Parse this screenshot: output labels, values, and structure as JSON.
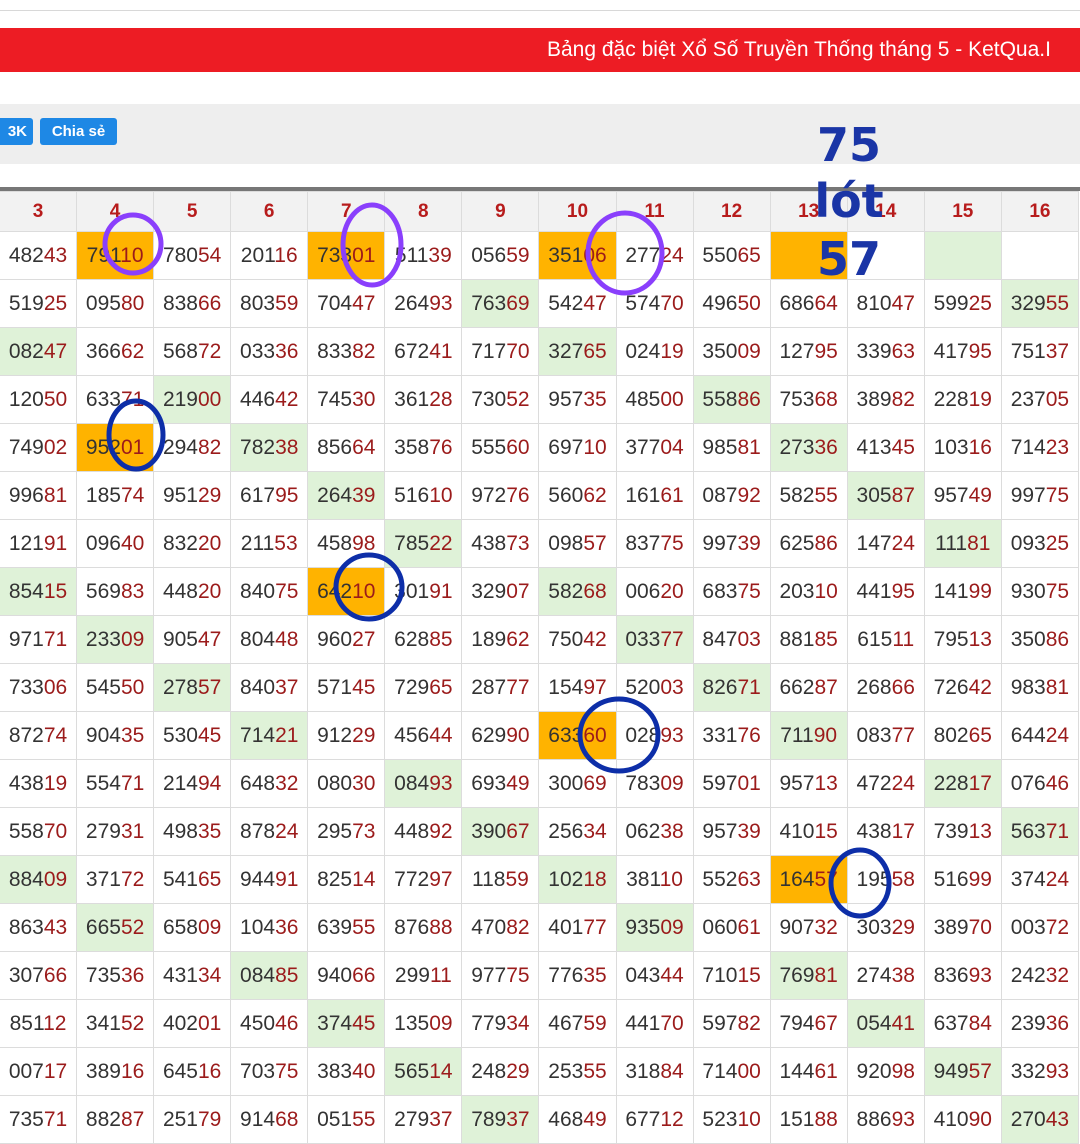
{
  "title": "Bảng đặc biệt Xổ Số Truyền Thống tháng 5 - KetQua.I",
  "toolbar": {
    "btn_1": "3K",
    "btn_2": "Chia sẻ"
  },
  "colors": {
    "title_bg": "#ed1c24",
    "button": "#1e88e5",
    "highlight_yellow": "#ffb300",
    "highlight_green": "#dff2d8",
    "circle_purple": "#8a3ffc",
    "circle_blue": "#0d2ea8",
    "annotation_text": "#1a35a6"
  },
  "headers": [
    "3",
    "4",
    "5",
    "6",
    "7",
    "8",
    "9",
    "10",
    "11",
    "12",
    "13",
    "14",
    "15",
    "16"
  ],
  "rows": [
    [
      "48243",
      "79110",
      "78054",
      "20116",
      "73301",
      "51139",
      "05659",
      "35106",
      "27724",
      "55065",
      "",
      "",
      "",
      ""
    ],
    [
      "51925",
      "09580",
      "83866",
      "80359",
      "70447",
      "26493",
      "76369",
      "54247",
      "57470",
      "49650",
      "68664",
      "81047",
      "59925",
      "32955"
    ],
    [
      "08247",
      "36662",
      "56872",
      "03336",
      "83382",
      "67241",
      "71770",
      "32765",
      "02419",
      "35009",
      "12795",
      "33963",
      "41795",
      "75137"
    ],
    [
      "12050",
      "63371",
      "21900",
      "44642",
      "74530",
      "36128",
      "73052",
      "95735",
      "48500",
      "55886",
      "75368",
      "38982",
      "22819",
      "23705"
    ],
    [
      "74902",
      "95201",
      "29482",
      "78238",
      "85664",
      "35876",
      "55560",
      "69710",
      "37704",
      "98581",
      "27336",
      "41345",
      "10316",
      "71423"
    ],
    [
      "99681",
      "18574",
      "95129",
      "61795",
      "26439",
      "51610",
      "97276",
      "56062",
      "16161",
      "08792",
      "58255",
      "30587",
      "95749",
      "99775"
    ],
    [
      "12191",
      "09640",
      "83220",
      "21153",
      "45898",
      "78522",
      "43873",
      "09857",
      "83775",
      "99739",
      "62586",
      "14724",
      "11181",
      "09325"
    ],
    [
      "85415",
      "56983",
      "44820",
      "84075",
      "64210",
      "30191",
      "32907",
      "58268",
      "00620",
      "68375",
      "20310",
      "44195",
      "14199",
      "93075"
    ],
    [
      "97171",
      "23309",
      "90547",
      "80448",
      "96027",
      "62885",
      "18962",
      "75042",
      "03377",
      "84703",
      "88185",
      "61511",
      "79513",
      "35086"
    ],
    [
      "73306",
      "54550",
      "27857",
      "84037",
      "57145",
      "72965",
      "28777",
      "15497",
      "52003",
      "82671",
      "66287",
      "26866",
      "72642",
      "98381"
    ],
    [
      "87274",
      "90435",
      "53045",
      "71421",
      "91229",
      "45644",
      "62990",
      "63360",
      "02893",
      "33176",
      "71190",
      "08377",
      "80265",
      "64424"
    ],
    [
      "43819",
      "55471",
      "21494",
      "64832",
      "08030",
      "08493",
      "69349",
      "30069",
      "78309",
      "59701",
      "95713",
      "47224",
      "22817",
      "07646"
    ],
    [
      "55870",
      "27931",
      "49835",
      "87824",
      "29573",
      "44892",
      "39067",
      "25634",
      "06238",
      "95739",
      "41015",
      "43817",
      "73913",
      "56371"
    ],
    [
      "88409",
      "37172",
      "54165",
      "94491",
      "82514",
      "77297",
      "11859",
      "10218",
      "38110",
      "55263",
      "16457",
      "19558",
      "51699",
      "37424"
    ],
    [
      "86343",
      "66552",
      "65809",
      "10436",
      "63955",
      "87688",
      "47082",
      "40177",
      "93509",
      "06061",
      "90732",
      "30329",
      "38970",
      "00372"
    ],
    [
      "30766",
      "73536",
      "43134",
      "08485",
      "94066",
      "29911",
      "97775",
      "77635",
      "04344",
      "71015",
      "76981",
      "27438",
      "83693",
      "24232"
    ],
    [
      "85112",
      "34152",
      "40201",
      "45046",
      "37445",
      "13509",
      "77934",
      "46759",
      "44170",
      "59782",
      "79467",
      "05441",
      "63784",
      "23936"
    ],
    [
      "00717",
      "38916",
      "64516",
      "70375",
      "38340",
      "56514",
      "24829",
      "25355",
      "31884",
      "71400",
      "14461",
      "92098",
      "94957",
      "33293"
    ],
    [
      "73571",
      "88287",
      "25179",
      "91468",
      "05155",
      "27937",
      "78937",
      "46849",
      "67712",
      "52310",
      "15188",
      "88693",
      "41090",
      "27043"
    ]
  ],
  "yellow_cells": [
    [
      0,
      1
    ],
    [
      0,
      4
    ],
    [
      0,
      7
    ],
    [
      0,
      10
    ],
    [
      4,
      1
    ],
    [
      7,
      4
    ],
    [
      10,
      7
    ],
    [
      13,
      10
    ]
  ],
  "green_cells": [
    [
      0,
      12
    ],
    [
      1,
      6
    ],
    [
      1,
      13
    ],
    [
      2,
      0
    ],
    [
      2,
      7
    ],
    [
      3,
      2
    ],
    [
      3,
      9
    ],
    [
      4,
      3
    ],
    [
      4,
      10
    ],
    [
      5,
      4
    ],
    [
      5,
      11
    ],
    [
      6,
      5
    ],
    [
      6,
      12
    ],
    [
      7,
      0
    ],
    [
      7,
      7
    ],
    [
      8,
      1
    ],
    [
      8,
      8
    ],
    [
      9,
      2
    ],
    [
      9,
      9
    ],
    [
      10,
      3
    ],
    [
      10,
      10
    ],
    [
      11,
      5
    ],
    [
      11,
      12
    ],
    [
      12,
      6
    ],
    [
      12,
      13
    ],
    [
      13,
      0
    ],
    [
      13,
      7
    ],
    [
      14,
      1
    ],
    [
      14,
      8
    ],
    [
      15,
      3
    ],
    [
      15,
      10
    ],
    [
      16,
      4
    ],
    [
      16,
      11
    ],
    [
      17,
      5
    ],
    [
      17,
      12
    ],
    [
      18,
      6
    ],
    [
      18,
      13
    ]
  ],
  "annotations": {
    "line1": "75",
    "line2": "lót",
    "line3": "57"
  }
}
